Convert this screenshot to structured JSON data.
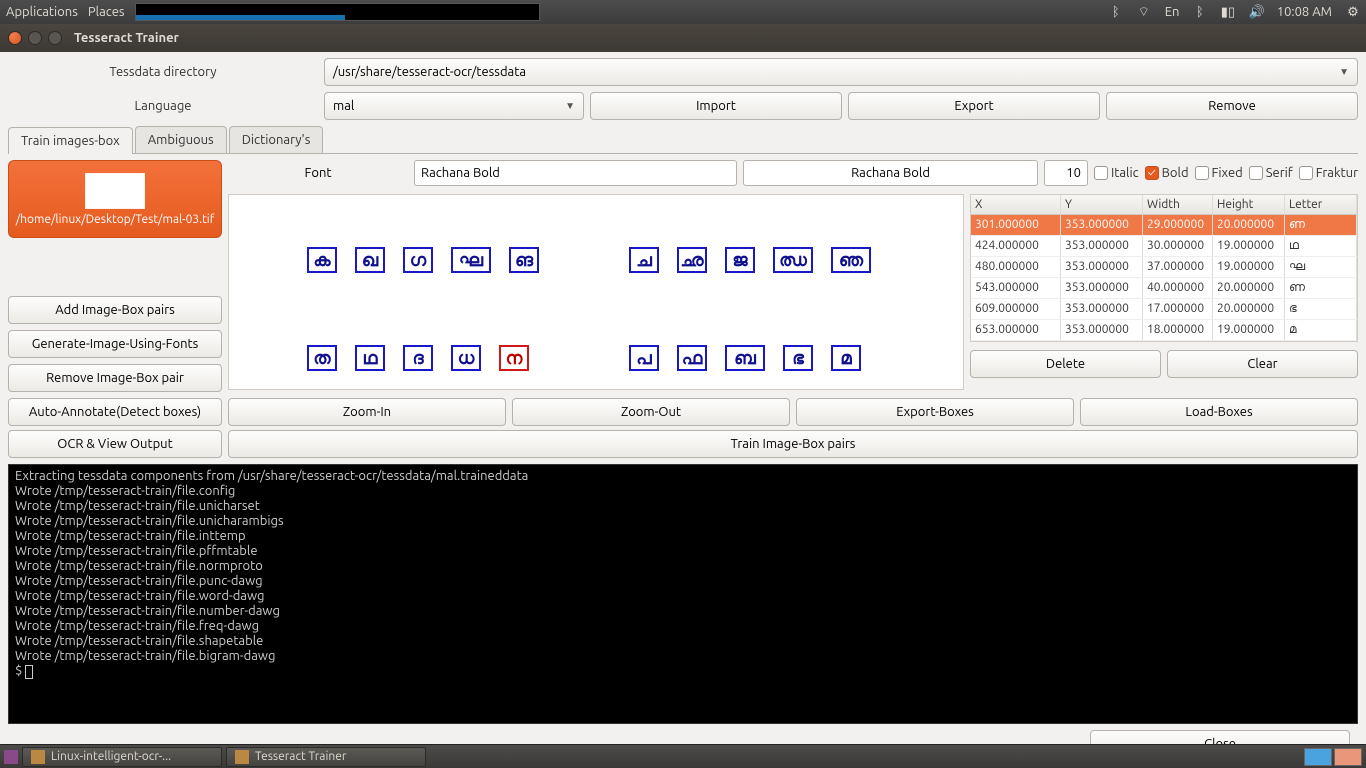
{
  "panel": {
    "applications": "Applications",
    "places": "Places",
    "lang_indicator": "En",
    "time": "10:08 AM"
  },
  "window": {
    "title": "Tesseract Trainer"
  },
  "form": {
    "tessdata_label": "Tessdata directory",
    "tessdata_value": "/usr/share/tesseract-ocr/tessdata",
    "language_label": "Language",
    "language_value": "mal",
    "import": "Import",
    "export": "Export",
    "remove": "Remove"
  },
  "tabs": {
    "t0": "Train images-box",
    "t1": "Ambiguous",
    "t2": "Dictionary's"
  },
  "thumb": {
    "path": "/home/linux/Desktop/Test/mal-03.tif"
  },
  "side_buttons": {
    "add": "Add Image-Box pairs",
    "gen": "Generate-Image-Using-Fonts",
    "remove": "Remove Image-Box pair",
    "auto": "Auto-Annotate(Detect boxes)",
    "ocr": "OCR & View Output"
  },
  "font_row": {
    "label": "Font",
    "name": "Rachana Bold",
    "desc": "Rachana Bold",
    "size": "10",
    "italic": "Italic",
    "bold": "Bold",
    "fixed": "Fixed",
    "serif": "Serif",
    "fraktur": "Fraktur"
  },
  "table": {
    "hX": "X",
    "hY": "Y",
    "hW": "Width",
    "hH": "Height",
    "hL": "Letter",
    "rows": [
      {
        "x": "301.000000",
        "y": "353.000000",
        "w": "29.000000",
        "h": "20.000000",
        "l": "ണ"
      },
      {
        "x": "424.000000",
        "y": "353.000000",
        "w": "30.000000",
        "h": "19.000000",
        "l": "ഥ"
      },
      {
        "x": "480.000000",
        "y": "353.000000",
        "w": "37.000000",
        "h": "19.000000",
        "l": "ഘ"
      },
      {
        "x": "543.000000",
        "y": "353.000000",
        "w": "40.000000",
        "h": "20.000000",
        "l": "ണ"
      },
      {
        "x": "609.000000",
        "y": "353.000000",
        "w": "17.000000",
        "h": "20.000000",
        "l": "ഭ"
      },
      {
        "x": "653.000000",
        "y": "353.000000",
        "w": "18.000000",
        "h": "19.000000",
        "l": "മ"
      }
    ],
    "delete": "Delete",
    "clear": "Clear"
  },
  "zoom": {
    "in": "Zoom-In",
    "out": "Zoom-Out",
    "exportb": "Export-Boxes",
    "loadb": "Load-Boxes"
  },
  "train_btn": "Train Image-Box pairs",
  "terminal_lines": "Extracting tessdata components from /usr/share/tesseract-ocr/tessdata/mal.traineddata\nWrote /tmp/tesseract-train/file.config\nWrote /tmp/tesseract-train/file.unicharset\nWrote /tmp/tesseract-train/file.unicharambigs\nWrote /tmp/tesseract-train/file.inttemp\nWrote /tmp/tesseract-train/file.pffmtable\nWrote /tmp/tesseract-train/file.normproto\nWrote /tmp/tesseract-train/file.punc-dawg\nWrote /tmp/tesseract-train/file.word-dawg\nWrote /tmp/tesseract-train/file.number-dawg\nWrote /tmp/tesseract-train/file.freq-dawg\nWrote /tmp/tesseract-train/file.shapetable\nWrote /tmp/tesseract-train/file.bigram-dawg\n$ ",
  "close": "Close",
  "taskbar": {
    "t0": "Linux-intelligent-ocr-...",
    "t1": "Tesseract Trainer"
  },
  "glyphs": {
    "r1": [
      "ക",
      "ഖ",
      "ഗ",
      "ഘ",
      "ങ"
    ],
    "r1b": [
      "ച",
      "ഛ",
      "ജ",
      "ഝ",
      "ഞ"
    ],
    "r2": [
      "ത",
      "ഥ",
      "ദ",
      "ധ",
      "ന"
    ],
    "r2b": [
      "പ",
      "ഫ",
      "ബ",
      "ഭ",
      "മ"
    ]
  }
}
